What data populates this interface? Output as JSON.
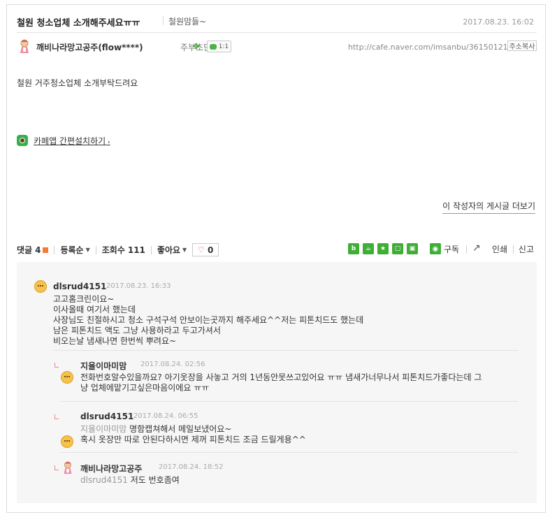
{
  "post": {
    "title": "철원 청소업체 소개해주세요ㅠㅠ",
    "board": "철원맘들~",
    "date": "2017.08.23. 16:02",
    "author": "깨비나라망고공주(flow****)",
    "rank": "주부초단",
    "chat_label": "1:1",
    "url": "http://cafe.naver.com/imsanbu/36150121",
    "copy_label": "주소복사",
    "content": "철원 거주청소업체 소개부탁드려요",
    "app_link": "카페앱 간편설치하기",
    "more_posts": "이 작성자의 게시글 더보기"
  },
  "toolbar": {
    "comments_label": "댓글",
    "comments_count": "4",
    "sort_label": "등록순",
    "views_label": "조회수",
    "views_count": "111",
    "like_label": "좋아요",
    "like_count": "0",
    "subscribe_label": "구독",
    "print_label": "인쇄",
    "report_label": "신고",
    "share_icons": [
      "blog",
      "cafe",
      "bookmark",
      "memo",
      "post"
    ]
  },
  "comments": [
    {
      "author": "dlsrud4151",
      "date": "2017.08.23. 16:33",
      "lines": [
        "고고홈크린이요~",
        "이사올때 여기서 했는데",
        "사장님도 친절하시고 청소 구석구석 안보이는곳까지 해주세요^^저는 피톤치드도 했는데",
        "남은 피톤치드 액도 그냥 사용하라고 두고가셔서",
        "비오는날 냄새나면 한번씩 뿌려요~"
      ]
    },
    {
      "author": "지율이마미맘",
      "date": "2017.08.24. 02:56",
      "lines": [
        "전화번호알수있을까요? 아기옷장을 사놓고 거의 1년동안못쓰고있어요 ㅠㅠ 냄새가너무나서 피톤치드가좋다는데 그",
        "냥 업체에맡기고싶은마음이에요 ㅠㅠ"
      ]
    },
    {
      "author": "dlsrud4151",
      "date": "2017.08.24. 06:55",
      "mention": "지율이마미맘",
      "lines": [
        "명함캡쳐해서 메일보냈어요~",
        "혹시 옷장만 따로 안된다하시면 제꺼 피톤치드 조금 드릴게용^^"
      ]
    },
    {
      "author": "깨비나라망고공주",
      "date": "2017.08.24. 18:52",
      "mention": "dlsrud4151",
      "lines": [
        "저도 번호좀여"
      ]
    }
  ],
  "colors": {
    "green": "#3fae35",
    "like_heart": "#e03c3c",
    "comment_bg": "#f6f6f6"
  }
}
